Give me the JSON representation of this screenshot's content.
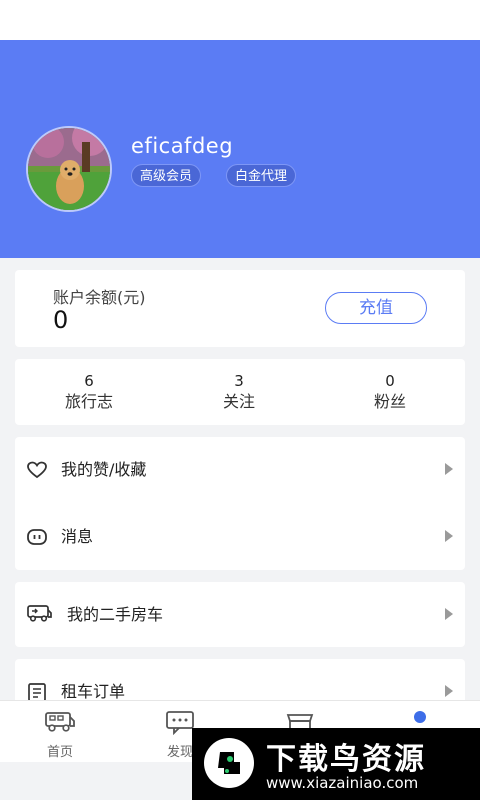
{
  "profile": {
    "username": "eficafdeg",
    "badges": [
      "高级会员",
      "白金代理"
    ]
  },
  "balance": {
    "label": "账户余额(元)",
    "value": "0",
    "recharge_label": "充值"
  },
  "stats": [
    {
      "count": "6",
      "label": "旅行志"
    },
    {
      "count": "3",
      "label": "关注"
    },
    {
      "count": "0",
      "label": "粉丝"
    }
  ],
  "menu": {
    "likes_label": "我的赞/收藏",
    "messages_label": "消息",
    "used_cars_label": "我的二手房车",
    "rental_orders_label": "租车订单"
  },
  "tabs": [
    {
      "label": "首页",
      "icon": "rv-icon"
    },
    {
      "label": "发现",
      "icon": "chat-icon"
    },
    {
      "label": "",
      "icon": "store-icon"
    },
    {
      "label": "",
      "icon": "person-icon"
    }
  ],
  "watermark": {
    "title": "下载鸟资源",
    "url": "www.xiazainiao.com"
  },
  "colors": {
    "accent": "#5b7cf4",
    "header_bg": "#5b7cf4",
    "badge_bg": "#4a67d6",
    "page_bg": "#f2f3f5"
  }
}
